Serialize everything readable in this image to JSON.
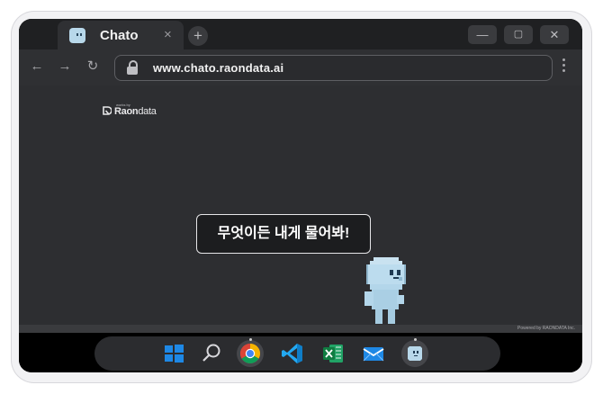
{
  "browser": {
    "tab": {
      "title": "Chato",
      "close_glyph": "×",
      "favicon": "chato-favicon"
    },
    "new_tab_glyph": "+",
    "window_controls": {
      "minimize": "—",
      "maximize": "▢",
      "close": "✕"
    },
    "toolbar": {
      "back": "←",
      "forward": "→",
      "reload": "↻"
    },
    "url": "www.chato.raondata.ai"
  },
  "page": {
    "logo": {
      "tagline": "works by",
      "name_bold": "Raon",
      "name_regular": "data"
    },
    "speech_bubble": "무엇이든 내게 물어봐!",
    "footer": "Powered by RAONDATA Inc."
  },
  "taskbar": {
    "apps": [
      {
        "name": "windows-start",
        "icon": "windows-logo-icon"
      },
      {
        "name": "search",
        "icon": "search-icon"
      },
      {
        "name": "chrome",
        "icon": "chrome-icon"
      },
      {
        "name": "vscode",
        "icon": "vscode-icon"
      },
      {
        "name": "excel",
        "icon": "excel-icon"
      },
      {
        "name": "mail",
        "icon": "mail-icon"
      },
      {
        "name": "chato",
        "icon": "chato-icon"
      }
    ]
  },
  "colors": {
    "accent_blue": "#1e88e5",
    "chato_body": "#b8d8ea",
    "page_bg": "#2d2e31"
  }
}
